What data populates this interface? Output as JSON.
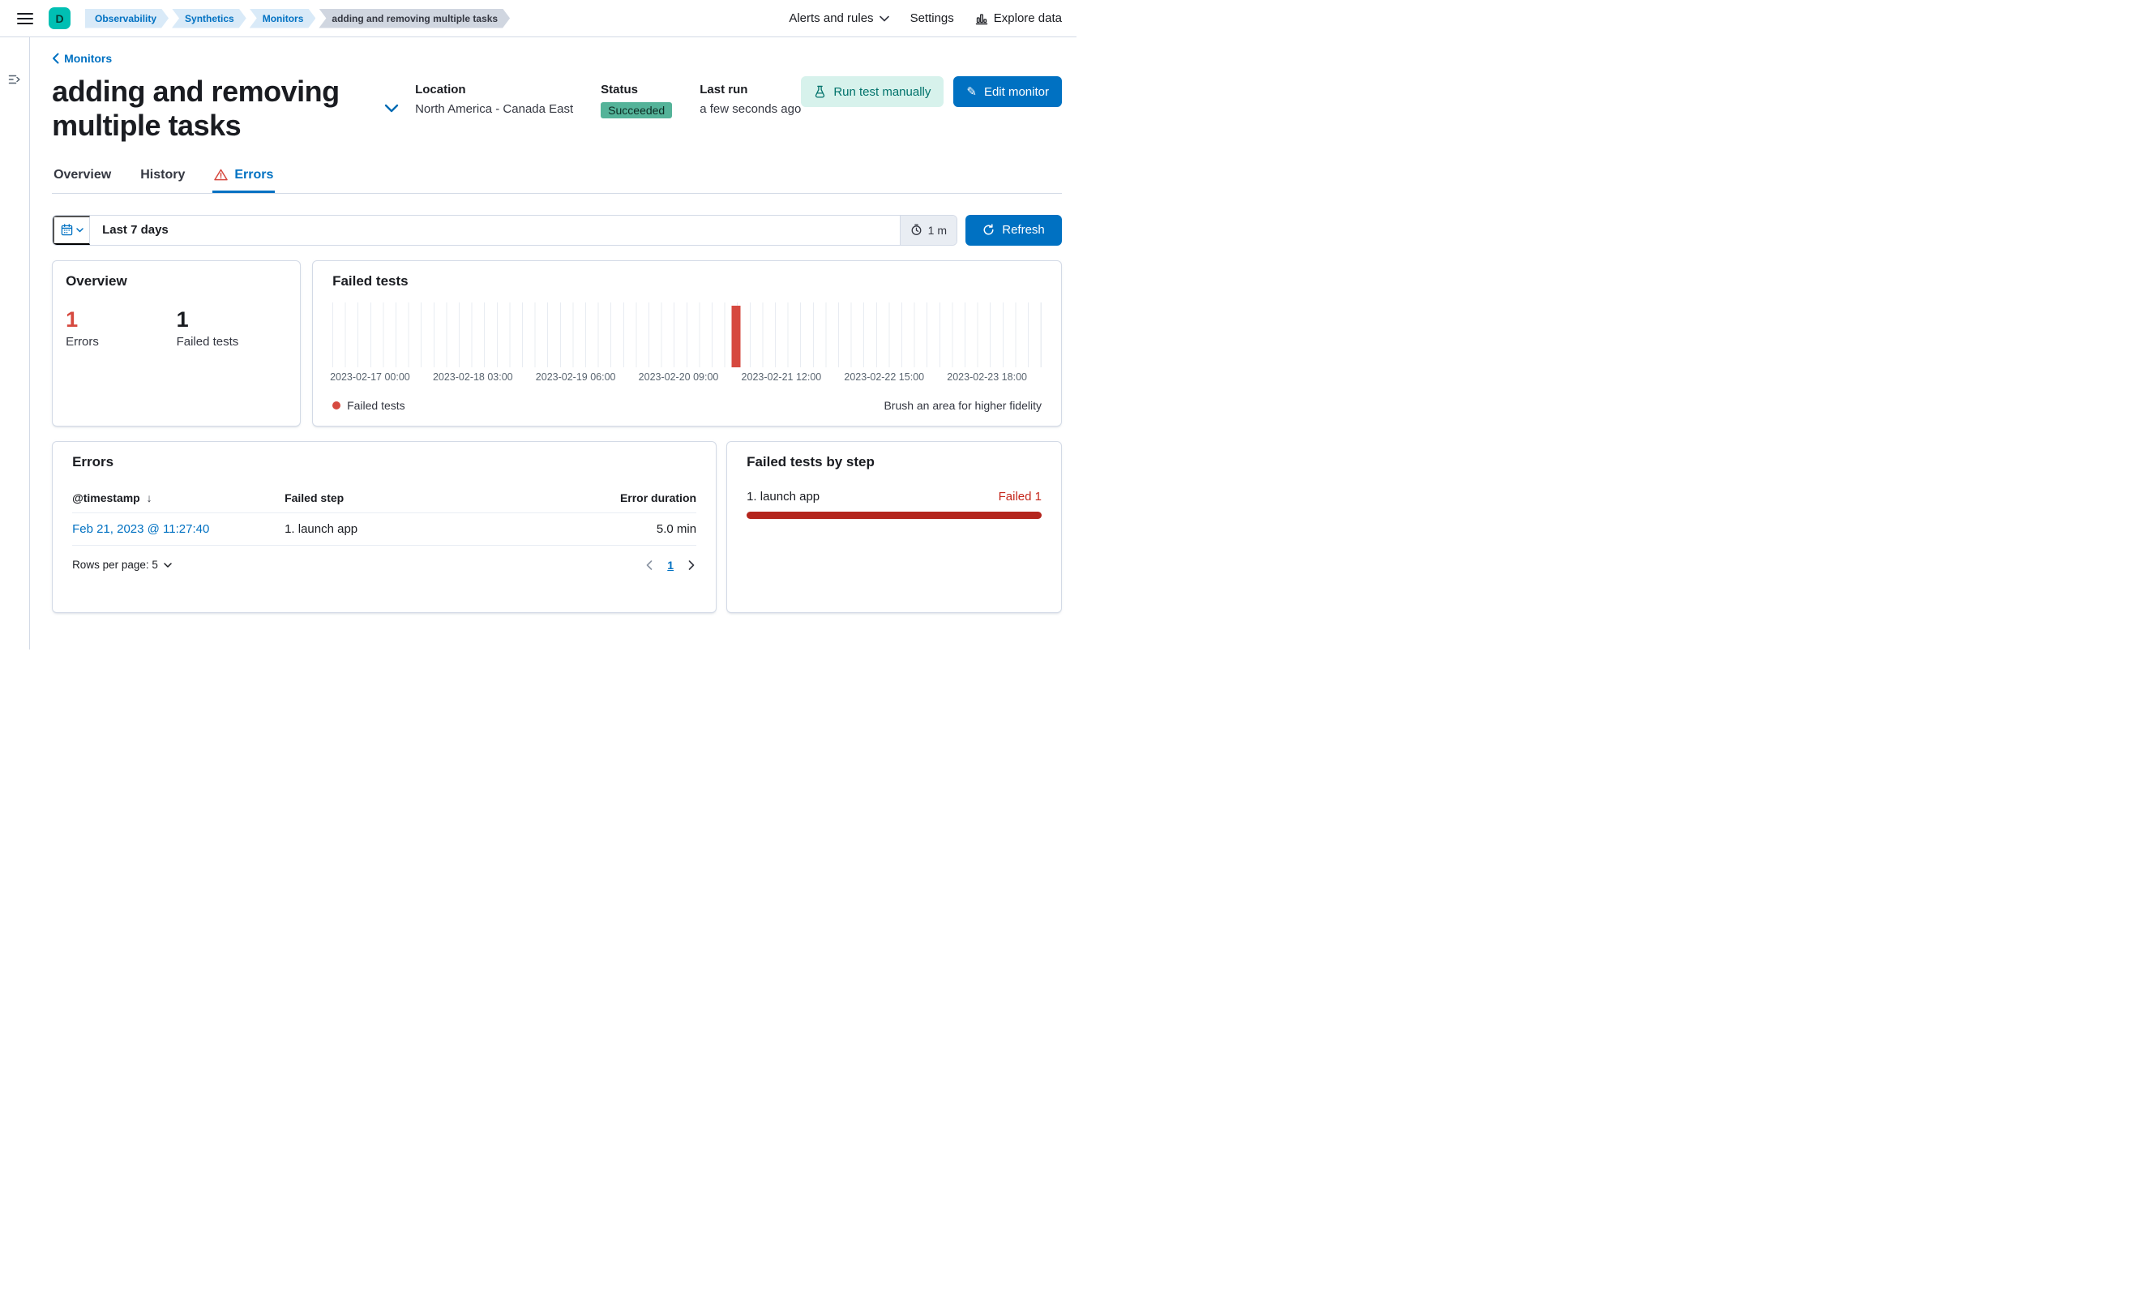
{
  "colors": {
    "primary": "#0071c2",
    "red": "#d6493f",
    "dark_red": "#b4251d",
    "danger_text": "#c4261b",
    "success_bg": "#54b399",
    "teal_bg": "#d7f2ec",
    "teal_text": "#00726b"
  },
  "icons": {
    "sort_desc": "↓",
    "pencil": "✎"
  },
  "topbar": {
    "space_badge": "D",
    "breadcrumbs": [
      "Observability",
      "Synthetics",
      "Monitors",
      "adding and removing multiple tasks"
    ],
    "alerts_menu": "Alerts and rules",
    "settings": "Settings",
    "explore_data": "Explore data"
  },
  "header": {
    "back_link": "Monitors",
    "title": "adding and removing multiple tasks",
    "location_label": "Location",
    "location_value": "North America - Canada East",
    "status_label": "Status",
    "status_value": "Succeeded",
    "last_run_label": "Last run",
    "last_run_value": "a few seconds ago",
    "run_test_button": "Run test manually",
    "edit_button": "Edit monitor"
  },
  "tabs": {
    "overview": "Overview",
    "history": "History",
    "errors": "Errors"
  },
  "time_controls": {
    "range": "Last 7 days",
    "interval": "1 m",
    "refresh": "Refresh"
  },
  "overview_card": {
    "title": "Overview",
    "errors_value": "1",
    "errors_label": "Errors",
    "failed_value": "1",
    "failed_label": "Failed tests"
  },
  "failed_tests_card": {
    "title": "Failed tests",
    "legend": "Failed tests",
    "hint": "Brush an area for higher fidelity",
    "chart_data": {
      "type": "bar",
      "x_ticks": [
        "2023-02-17 00:00",
        "2023-02-18 03:00",
        "2023-02-19 06:00",
        "2023-02-20 09:00",
        "2023-02-21 12:00",
        "2023-02-22 15:00",
        "2023-02-23 18:00"
      ],
      "series": [
        {
          "name": "Failed tests",
          "points": [
            {
              "x": "2023-02-21 11:27",
              "y": 1
            }
          ]
        }
      ],
      "ylim": [
        0,
        1
      ],
      "bar_x_percent": 57,
      "grid": "vertical-only",
      "legend_position": "bottom-left"
    }
  },
  "errors_card": {
    "title": "Errors",
    "columns": [
      "@timestamp",
      "Failed step",
      "Error duration"
    ],
    "rows": [
      {
        "timestamp": "Feb 21, 2023 @ 11:27:40",
        "failed_step": "1. launch app",
        "error_duration": "5.0 min"
      }
    ],
    "rows_per_page": "Rows per page: 5",
    "page": "1"
  },
  "failed_by_step_card": {
    "title": "Failed tests by step",
    "step": "1. launch app",
    "count_label": "Failed 1"
  }
}
